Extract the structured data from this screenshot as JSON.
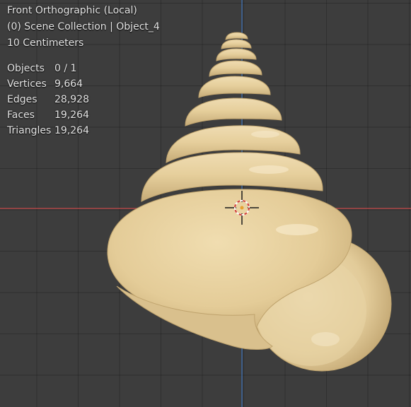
{
  "viewport": {
    "view_name": "Front Orthographic (Local)",
    "collection_info": "(0) Scene Collection | Object_4",
    "grid_scale": "10 Centimeters",
    "stats": [
      {
        "label": "Objects",
        "value": "0 / 1"
      },
      {
        "label": "Vertices",
        "value": "9,664"
      },
      {
        "label": "Edges",
        "value": "28,928"
      },
      {
        "label": "Faces",
        "value": "19,264"
      },
      {
        "label": "Triangles",
        "value": "19,264"
      }
    ]
  },
  "colors": {
    "background": "#3d3d3d",
    "x_axis": "#c44a4a",
    "z_axis": "#3e6fb0",
    "model": "#e7d1a0"
  },
  "icons": {
    "cursor": "3d-cursor-icon"
  }
}
